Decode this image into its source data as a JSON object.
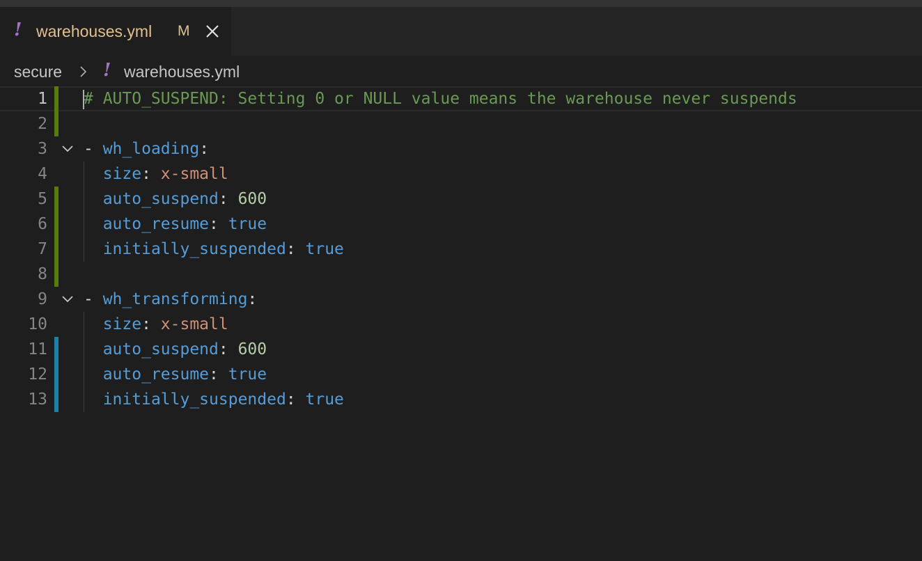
{
  "tab": {
    "file_icon": "!",
    "title": "warehouses.yml",
    "modified_badge": "M",
    "close_icon": "close-icon"
  },
  "breadcrumb": {
    "folder": "secure",
    "file_icon": "!",
    "file": "warehouses.yml"
  },
  "editor": {
    "language": "yaml",
    "cursor_line": 1,
    "lines": [
      {
        "num": "1",
        "comment": "# AUTO_SUSPEND: Setting 0 or NULL value means the warehouse never suspends",
        "change": "added"
      },
      {
        "num": "2",
        "change": "added"
      },
      {
        "num": "3",
        "dash": "- ",
        "key": "wh_loading",
        "colon": ":",
        "foldable": true
      },
      {
        "num": "4",
        "indent": "  ",
        "key": "size",
        "colon": ": ",
        "value": "x-small",
        "value_type": "string"
      },
      {
        "num": "5",
        "indent": "  ",
        "key": "auto_suspend",
        "colon": ": ",
        "value": "600",
        "value_type": "number",
        "change": "added"
      },
      {
        "num": "6",
        "indent": "  ",
        "key": "auto_resume",
        "colon": ": ",
        "value": "true",
        "value_type": "bool",
        "change": "added"
      },
      {
        "num": "7",
        "indent": "  ",
        "key": "initially_suspended",
        "colon": ": ",
        "value": "true",
        "value_type": "bool",
        "change": "added"
      },
      {
        "num": "8",
        "change": "added"
      },
      {
        "num": "9",
        "dash": "- ",
        "key": "wh_transforming",
        "colon": ":",
        "foldable": true
      },
      {
        "num": "10",
        "indent": "  ",
        "key": "size",
        "colon": ": ",
        "value": "x-small",
        "value_type": "string"
      },
      {
        "num": "11",
        "indent": "  ",
        "key": "auto_suspend",
        "colon": ": ",
        "value": "600",
        "value_type": "number",
        "change": "modified"
      },
      {
        "num": "12",
        "indent": "  ",
        "key": "auto_resume",
        "colon": ": ",
        "value": "true",
        "value_type": "bool",
        "change": "modified"
      },
      {
        "num": "13",
        "indent": "  ",
        "key": "initially_suspended",
        "colon": ": ",
        "value": "true",
        "value_type": "bool",
        "change": "modified"
      }
    ]
  },
  "colors": {
    "added": "#587c0c",
    "modified": "#1b81a8",
    "file_icon": "#a074c4",
    "modified_tab_text": "#e2c08d"
  }
}
